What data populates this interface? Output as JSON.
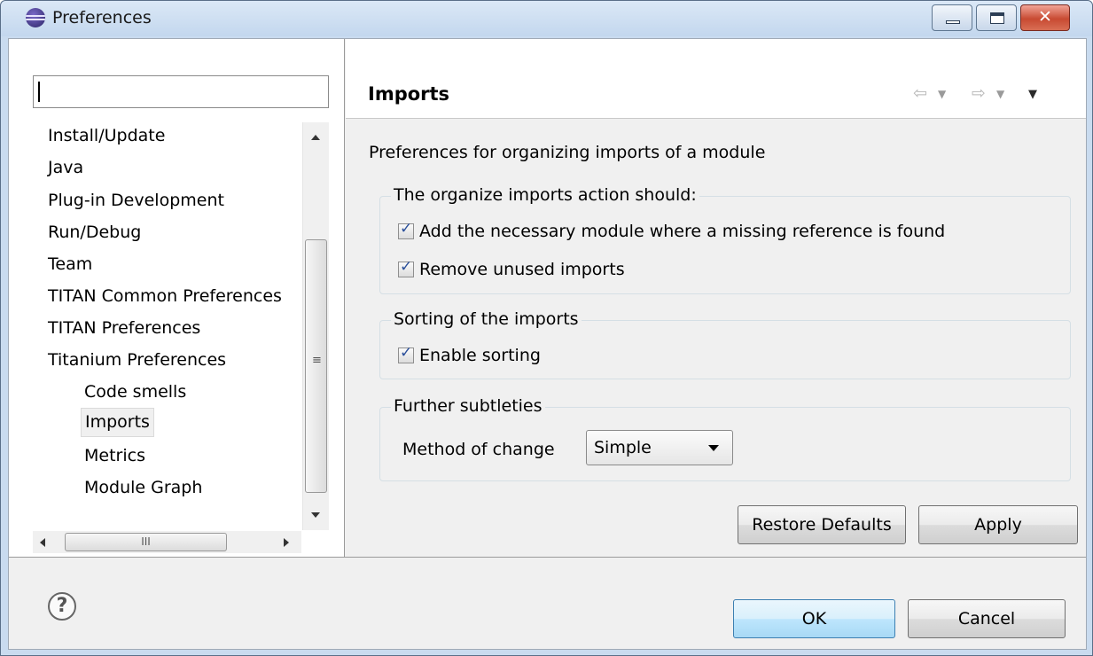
{
  "window": {
    "title": "Preferences",
    "close_glyph": "✕"
  },
  "filter": {
    "value": ""
  },
  "tree": {
    "items": [
      "Install/Update",
      "Java",
      "Plug-in Development",
      "Run/Debug",
      "Team",
      "TITAN Common Preferences",
      "TITAN Preferences",
      "Titanium Preferences",
      "Code smells",
      "Imports",
      "Metrics",
      "Module Graph"
    ],
    "selected": "Imports"
  },
  "page": {
    "title": "Imports",
    "description": "Preferences for organizing imports of a module",
    "nav": {
      "back": "⇦",
      "forward": "⇨",
      "dropdown": "▼"
    }
  },
  "groups": {
    "organize": {
      "legend": "The organize imports action should:",
      "add_module_label": "Add the necessary module where a missing reference is found",
      "add_module_checked": true,
      "remove_unused_label": "Remove unused imports",
      "remove_unused_checked": true
    },
    "sorting": {
      "legend": "Sorting of the imports",
      "enable_sorting_label": "Enable sorting",
      "enable_sorting_checked": true
    },
    "subtleties": {
      "legend": "Further subtleties",
      "method_label": "Method of change",
      "method_value": "Simple"
    }
  },
  "checkmark": "✓",
  "buttons": {
    "restore_defaults": "Restore Defaults",
    "apply": "Apply",
    "ok": "OK",
    "cancel": "Cancel",
    "help": "?"
  },
  "scroll": {
    "v_grip": "≡",
    "h_grip": "III"
  }
}
